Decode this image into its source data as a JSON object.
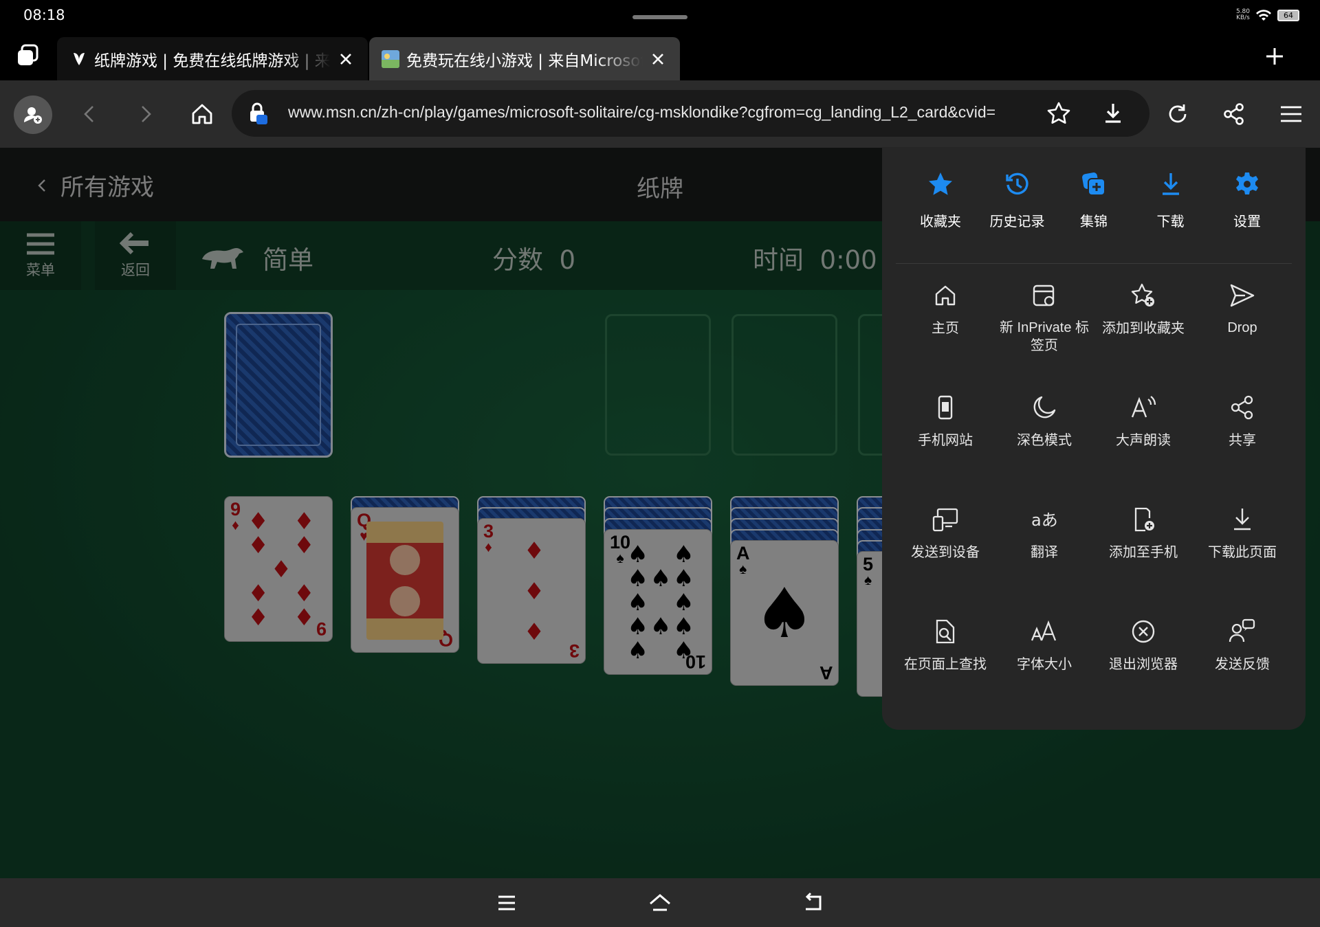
{
  "status": {
    "time": "08:18",
    "net_speed_value": "5.80",
    "net_speed_unit": "KB/s",
    "battery": "64"
  },
  "tabs": [
    {
      "title": "纸牌游戏 | 免费在线纸牌游戏 | 来",
      "active": true
    },
    {
      "title": "免费玩在线小游戏 | 来自Microsoft",
      "active": false
    }
  ],
  "address": {
    "url": "www.msn.cn/zh-cn/play/games/microsoft-solitaire/cg-msklondike?cgfrom=cg_landing_L2_card&cvid="
  },
  "page_header": {
    "back_label": "所有游戏",
    "title": "纸牌"
  },
  "game_bar": {
    "menu_label": "菜单",
    "back_label": "返回",
    "difficulty": "简单",
    "score_label": "分数",
    "score_value": "0",
    "time_label": "时间",
    "time_value": "0:00"
  },
  "tableau": [
    {
      "rank": "9",
      "suit": "♦",
      "color": "red",
      "face_down": 0
    },
    {
      "rank": "Q",
      "suit": "♥",
      "color": "red",
      "face_down": 1
    },
    {
      "rank": "3",
      "suit": "♦",
      "color": "red",
      "face_down": 2
    },
    {
      "rank": "10",
      "suit": "♠",
      "color": "black",
      "face_down": 3
    },
    {
      "rank": "A",
      "suit": "♠",
      "color": "black",
      "face_down": 4
    },
    {
      "rank": "5",
      "suit": "♠",
      "color": "black",
      "face_down": 5
    }
  ],
  "menu": {
    "top": [
      {
        "label": "收藏夹",
        "icon": "star-filled-icon"
      },
      {
        "label": "历史记录",
        "icon": "history-icon"
      },
      {
        "label": "集锦",
        "icon": "collections-icon"
      },
      {
        "label": "下载",
        "icon": "download-icon"
      },
      {
        "label": "设置",
        "icon": "settings-gear-icon"
      }
    ],
    "grid": [
      {
        "label": "主页",
        "icon": "home-icon"
      },
      {
        "label": "新 InPrivate 标签页",
        "icon": "inprivate-tab-icon"
      },
      {
        "label": "添加到收藏夹",
        "icon": "add-favorite-icon"
      },
      {
        "label": "Drop",
        "icon": "drop-send-icon"
      },
      {
        "label": "手机网站",
        "icon": "mobile-site-icon"
      },
      {
        "label": "深色模式",
        "icon": "moon-icon"
      },
      {
        "label": "大声朗读",
        "icon": "read-aloud-icon"
      },
      {
        "label": "共享",
        "icon": "share-icon"
      },
      {
        "label": "发送到设备",
        "icon": "send-to-device-icon"
      },
      {
        "label": "翻译",
        "icon": "translate-icon"
      },
      {
        "label": "添加至手机",
        "icon": "add-to-phone-icon"
      },
      {
        "label": "下载此页面",
        "icon": "download-page-icon"
      },
      {
        "label": "在页面上查找",
        "icon": "find-in-page-icon"
      },
      {
        "label": "字体大小",
        "icon": "font-size-icon"
      },
      {
        "label": "退出浏览器",
        "icon": "exit-icon"
      },
      {
        "label": "发送反馈",
        "icon": "feedback-icon"
      }
    ]
  },
  "colors": {
    "accent": "#1d8bf1",
    "felt": "#13482d",
    "panel": "#262626"
  }
}
